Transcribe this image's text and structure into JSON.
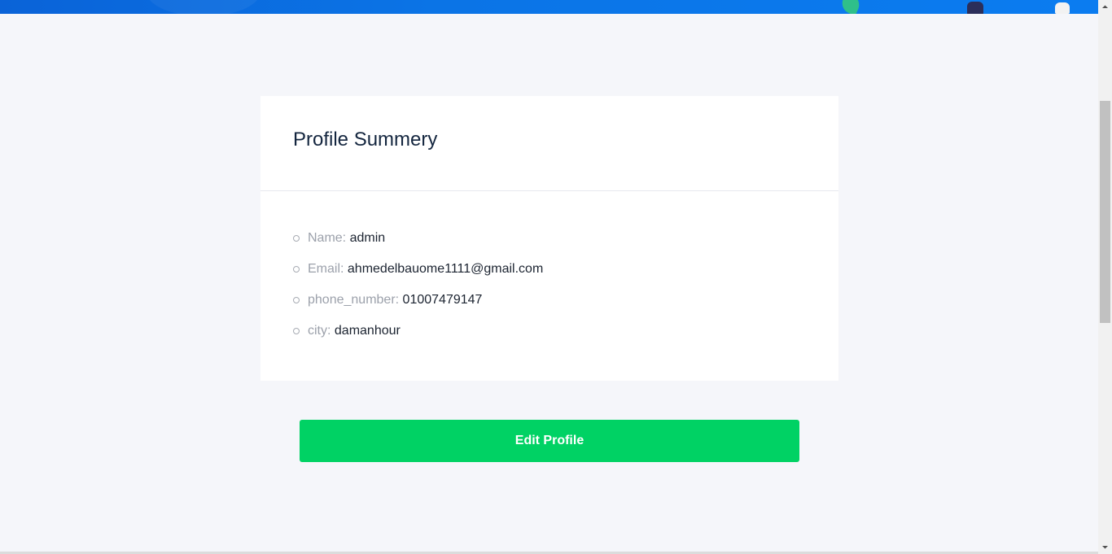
{
  "profile": {
    "title": "Profile Summery",
    "fields": [
      {
        "label": "Name:",
        "value": "admin"
      },
      {
        "label": "Email:",
        "value": "ahmedelbauome1111@gmail.com"
      },
      {
        "label": "phone_number:",
        "value": "01007479147"
      },
      {
        "label": "city:",
        "value": "damanhour"
      }
    ]
  },
  "actions": {
    "edit_label": "Edit Profile"
  },
  "colors": {
    "header_band": "#0b74e6",
    "accent_button": "#00d264",
    "background": "#f5f6fa",
    "card": "#ffffff"
  },
  "icons": {
    "bullet": "circle-bullet-icon",
    "scroll_up": "arrow-up-icon",
    "scroll_down": "arrow-down-icon"
  }
}
